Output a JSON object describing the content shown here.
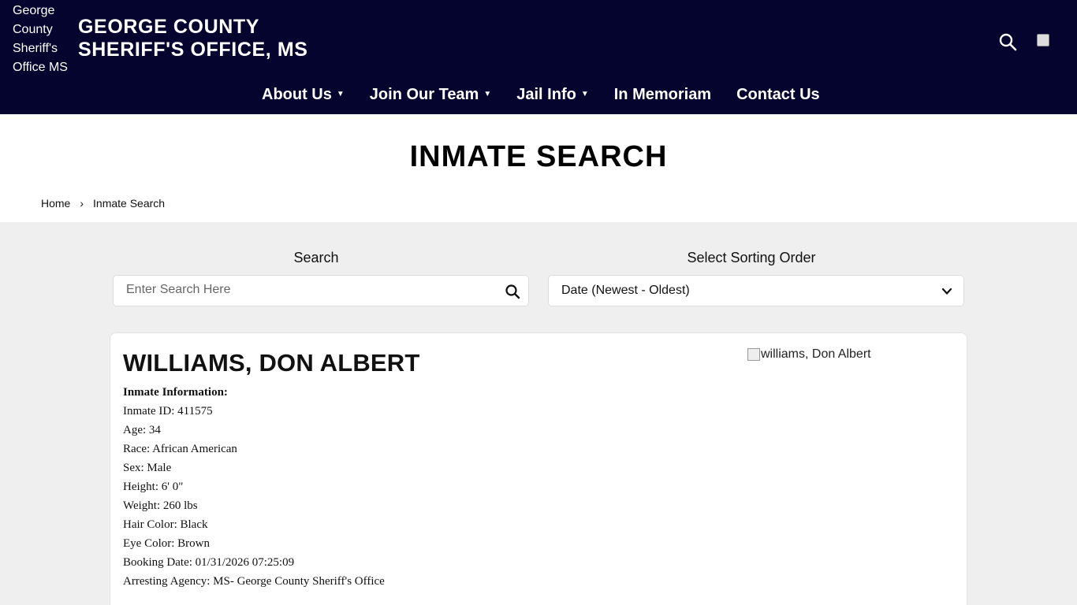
{
  "header": {
    "logo_alt": "George County Sheriff's Office MS",
    "title_line1": "GEORGE COUNTY",
    "title_line2": "SHERIFF'S OFFICE, MS",
    "search_icon": "search-icon",
    "user_image_icon": "broken-image-icon",
    "nav": [
      {
        "label": "About Us",
        "has_dropdown": true
      },
      {
        "label": "Join Our Team",
        "has_dropdown": true
      },
      {
        "label": "Jail Info",
        "has_dropdown": true
      },
      {
        "label": "In Memoriam",
        "has_dropdown": false
      },
      {
        "label": "Contact Us",
        "has_dropdown": false
      }
    ],
    "colors": {
      "background": "#04042e",
      "text": "#ffffff"
    }
  },
  "page": {
    "title": "INMATE SEARCH",
    "breadcrumb": {
      "home": "Home",
      "separator": "›",
      "current": "Inmate Search"
    }
  },
  "controls": {
    "search_label": "Search",
    "search_placeholder": "Enter Search Here",
    "search_value": "",
    "sort_label": "Select Sorting Order",
    "sort_value": "Date (Newest - Oldest)"
  },
  "inmate": {
    "name": "WILLIAMS, DON ALBERT",
    "photo_alt": "williams, Don Albert",
    "info_heading": "Inmate Information:",
    "fields": [
      "Inmate ID: 411575",
      "Age: 34",
      "Race: African American",
      "Sex: Male",
      "Height: 6' 0\"",
      "Weight: 260 lbs",
      "Hair Color: Black",
      "Eye Color: Brown",
      "Booking Date: 01/31/2026 07:25:09",
      "Arresting Agency: MS- George County Sheriff's Office"
    ]
  }
}
